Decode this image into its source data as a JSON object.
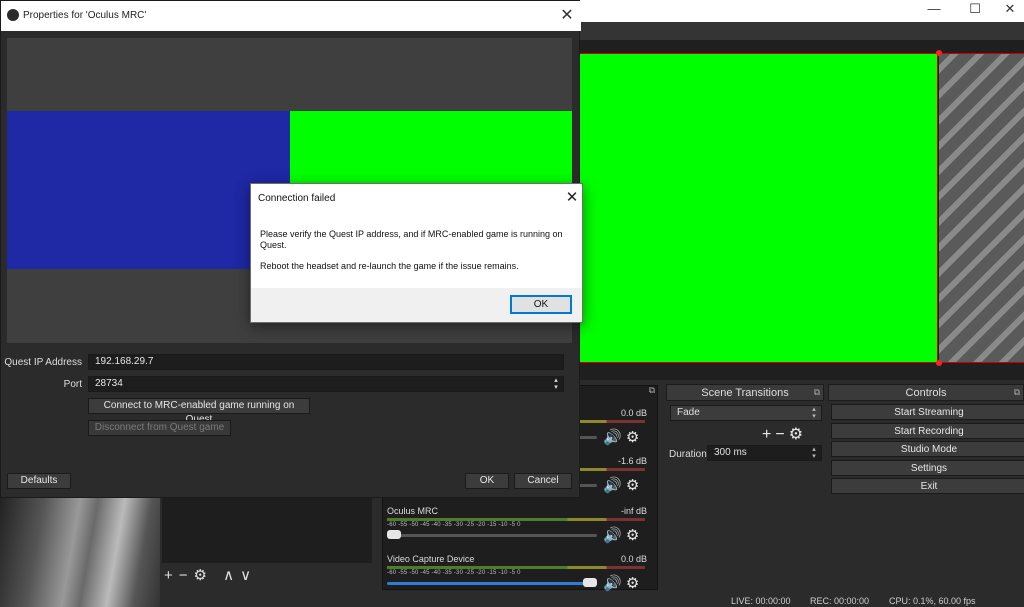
{
  "main_window": {
    "minimize_icon": "—",
    "maximize_icon": "☐",
    "close_icon": "✕"
  },
  "properties_dialog": {
    "title": "Properties for 'Oculus MRC'",
    "close_icon": "✕",
    "fields": {
      "ip_label": "Quest IP Address",
      "ip_value": "192.168.29.7",
      "port_label": "Port",
      "port_value": "28734"
    },
    "buttons": {
      "connect": "Connect to MRC-enabled game running on Quest",
      "disconnect": "Disconnect from Quest game",
      "defaults": "Defaults",
      "ok": "OK",
      "cancel": "Cancel"
    },
    "preview_colors": {
      "left": "#1f28a5",
      "right": "#00ff00"
    }
  },
  "message_box": {
    "title": "Connection failed",
    "close_icon": "✕",
    "line1": "Please verify the Quest IP address, and if MRC-enabled game is running on Quest.",
    "line2": "Reboot the headset and re-launch the game if the issue remains.",
    "ok": "OK"
  },
  "audio_mixer": {
    "channels": [
      {
        "name": "",
        "db": "0.0 dB",
        "fader": 0.05
      },
      {
        "name": "",
        "db": "-1.6 dB",
        "fader": 0.05
      },
      {
        "name": "Oculus MRC",
        "db": "-inf dB",
        "fader": 0.0
      },
      {
        "name": "Video Capture Device",
        "db": "0.0 dB",
        "fader": 1.0
      }
    ],
    "scale": "-60   -55   -50   -45   -40   -35   -30   -25   -20   -15   -10    -5    0",
    "mute_icon": "🔊",
    "gear_icon": "⚙"
  },
  "scene_transitions": {
    "title": "Scene Transitions",
    "transition": "Fade",
    "duration_label": "Duration",
    "duration_value": "300 ms",
    "add_icon": "+",
    "remove_icon": "−",
    "gear_icon": "⚙"
  },
  "controls": {
    "title": "Controls",
    "start_streaming": "Start Streaming",
    "start_recording": "Start Recording",
    "studio_mode": "Studio Mode",
    "settings": "Settings",
    "exit": "Exit"
  },
  "sources_toolbar": {
    "add": "+",
    "remove": "−",
    "gear": "⚙",
    "up": "∧",
    "down": "∨"
  },
  "status_bar": {
    "live": "LIVE: 00:00:00",
    "rec": "REC: 00:00:00",
    "cpu": "CPU: 0.1%, 60.00 fps"
  },
  "dock_float_icon": "⧉"
}
